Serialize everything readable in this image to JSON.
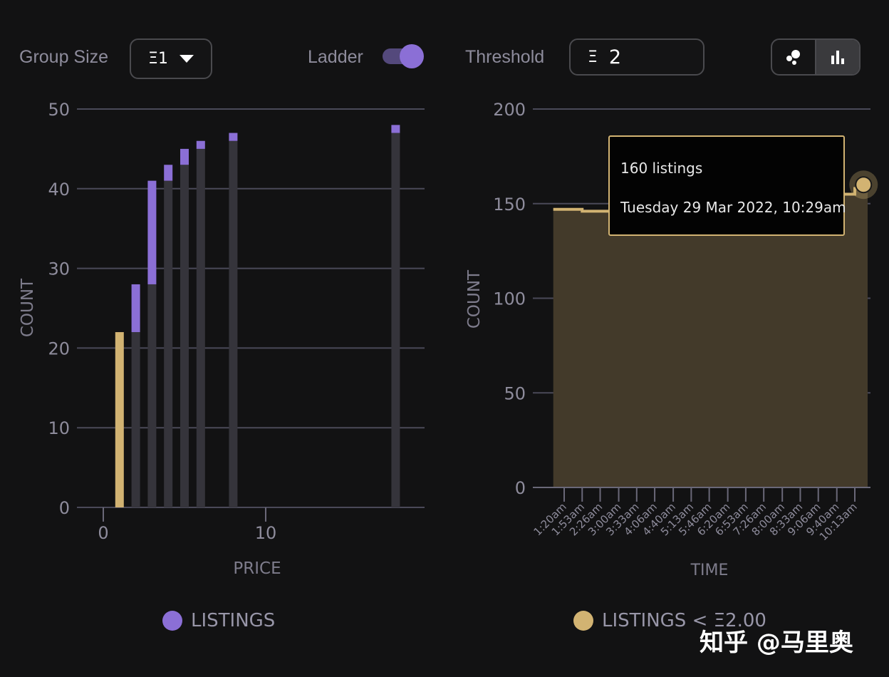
{
  "controls": {
    "group_size_label": "Group Size",
    "group_size_value": "Ξ1",
    "ladder_label": "Ladder",
    "ladder_on": true,
    "threshold_label": "Threshold",
    "threshold_symbol": "Ξ",
    "threshold_value": "2",
    "view_toggle": [
      {
        "icon": "scatter-icon",
        "active": false
      },
      {
        "icon": "bar-chart-icon",
        "active": true
      }
    ]
  },
  "colors": {
    "listings": "#8b6fd6",
    "below_threshold": "#d2b372",
    "base_bar": "#35343b",
    "area": "#433a2a",
    "background": "#121213"
  },
  "chart_data": [
    {
      "type": "bar",
      "stacked": true,
      "xlabel": "PRICE",
      "ylabel": "COUNT",
      "ylim": [
        0,
        50
      ],
      "yticks": [
        0,
        10,
        20,
        30,
        40,
        50
      ],
      "xticks": [
        0,
        10
      ],
      "grid": true,
      "legend": {
        "label": "LISTINGS",
        "placement": "bottom"
      },
      "bars": [
        {
          "price": 1,
          "base": 0,
          "top": 22,
          "below_threshold": true
        },
        {
          "price": 2,
          "base": 22,
          "top": 28
        },
        {
          "price": 3,
          "base": 28,
          "top": 41
        },
        {
          "price": 4,
          "base": 41,
          "top": 43
        },
        {
          "price": 5,
          "base": 43,
          "top": 45
        },
        {
          "price": 6,
          "base": 45,
          "top": 46
        },
        {
          "price": 8,
          "base": 46,
          "top": 47
        },
        {
          "price": 18,
          "base": 47,
          "top": 48
        }
      ]
    },
    {
      "type": "area",
      "xlabel": "TIME",
      "ylabel": "COUNT",
      "ylim": [
        0,
        200
      ],
      "yticks": [
        0,
        50,
        100,
        150,
        200
      ],
      "grid": true,
      "legend": {
        "label": "LISTINGS < Ξ2.00",
        "placement": "bottom"
      },
      "xticks": [
        "1:20am",
        "1:53am",
        "2:26am",
        "3:00am",
        "3:33am",
        "4:06am",
        "4:40am",
        "5:13am",
        "5:46am",
        "6:20am",
        "6:53am",
        "7:26am",
        "8:00am",
        "8:33am",
        "9:06am",
        "9:40am",
        "10:13am"
      ],
      "points": [
        {
          "time": "1:00am",
          "value": 147
        },
        {
          "time": "1:20am",
          "value": 147
        },
        {
          "time": "1:53am",
          "value": 146
        },
        {
          "time": "2:26am",
          "value": 146
        },
        {
          "time": "3:00am",
          "value": 146
        },
        {
          "time": "3:33am",
          "value": 148
        },
        {
          "time": "4:06am",
          "value": 150
        },
        {
          "time": "4:40am",
          "value": 151
        },
        {
          "time": "5:13am",
          "value": 150
        },
        {
          "time": "5:46am",
          "value": 150
        },
        {
          "time": "6:20am",
          "value": 150
        },
        {
          "time": "6:53am",
          "value": 150
        },
        {
          "time": "7:26am",
          "value": 150
        },
        {
          "time": "8:00am",
          "value": 151
        },
        {
          "time": "8:33am",
          "value": 150
        },
        {
          "time": "9:06am",
          "value": 155
        },
        {
          "time": "9:40am",
          "value": 155
        },
        {
          "time": "10:13am",
          "value": 158
        },
        {
          "time": "10:29am",
          "value": 160
        }
      ],
      "tooltip": {
        "line1": "160 listings",
        "line2": "Tuesday 29 Mar 2022, 10:29am"
      }
    }
  ],
  "watermark": "知乎 @马里奥"
}
